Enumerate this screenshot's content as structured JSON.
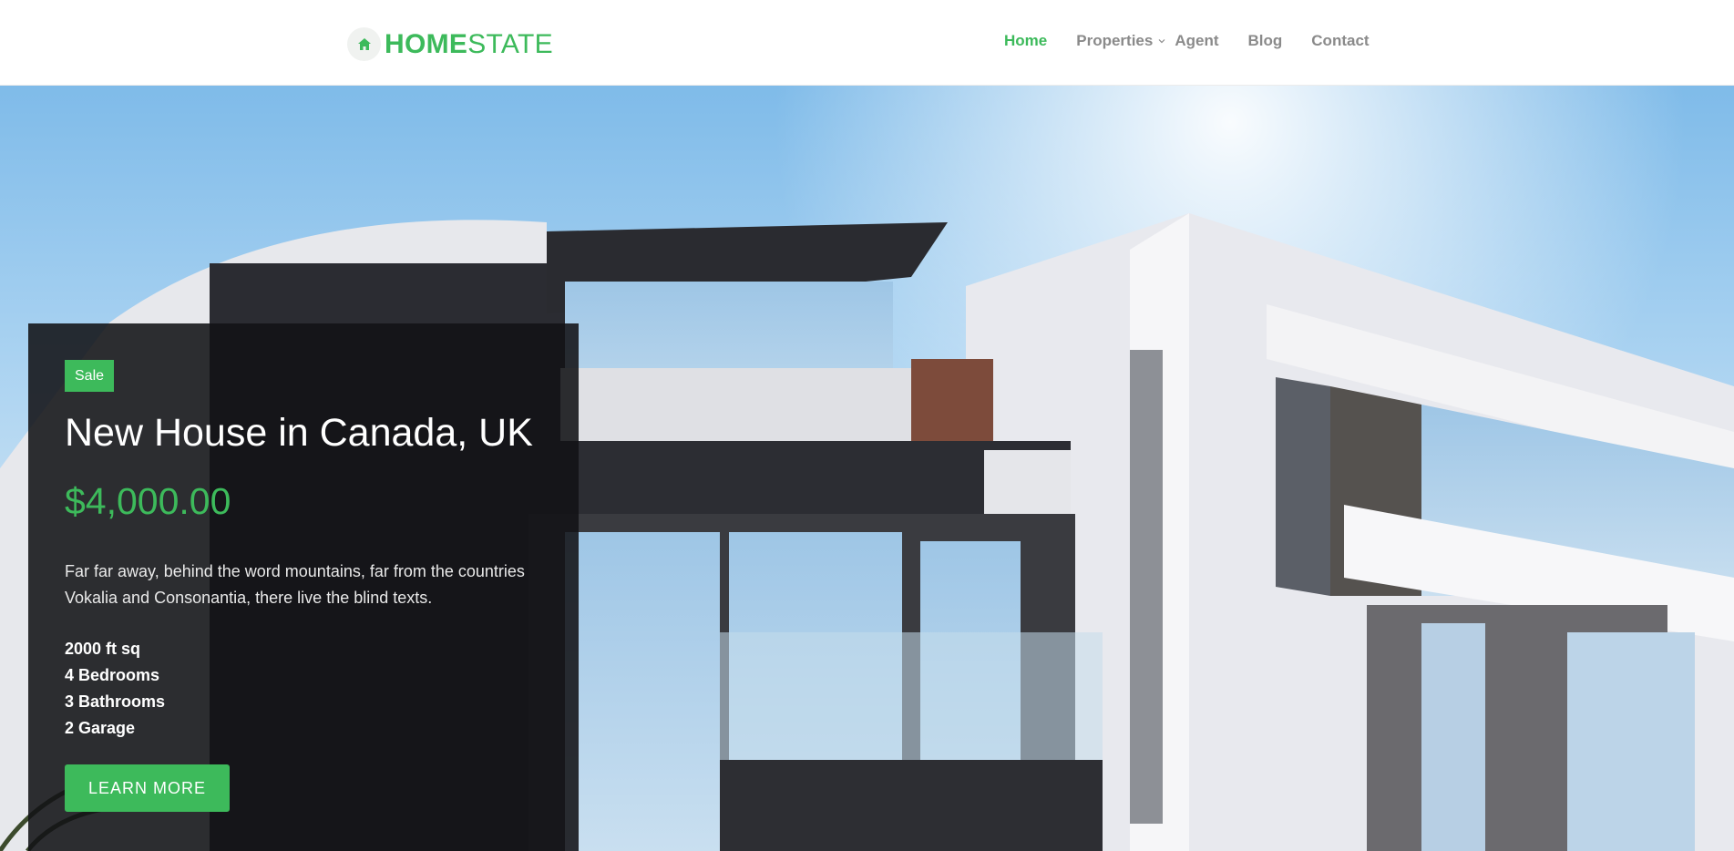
{
  "brand": {
    "bold": "HOME",
    "light": "STATE"
  },
  "nav": {
    "home": "Home",
    "properties": "Properties",
    "agent": "Agent",
    "blog": "Blog",
    "contact": "Contact"
  },
  "hero": {
    "badge": "Sale",
    "title": "New House in Canada, UK",
    "price": "$4,000.00",
    "description": "Far far away, behind the word mountains, far from the countries Vokalia and Consonantia, there live the blind texts.",
    "features": [
      "2000 ft sq",
      "4 Bedrooms",
      "3 Bathrooms",
      "2 Garage"
    ],
    "button": "LEARN MORE"
  },
  "colors": {
    "accent": "#3dba5b",
    "overlay": "#121216",
    "nav_text": "#8a8a8a"
  },
  "icons": {
    "logo": "home-icon",
    "dropdown": "chevron-down-icon"
  }
}
